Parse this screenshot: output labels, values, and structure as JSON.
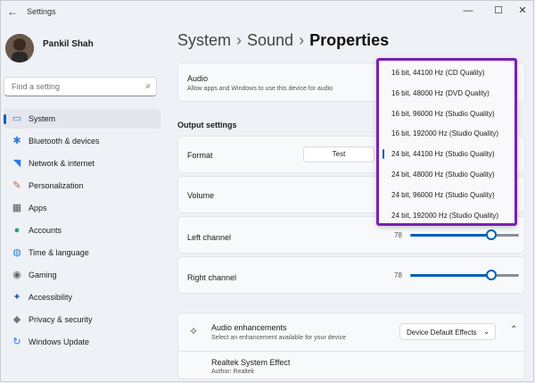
{
  "window": {
    "title": "Settings",
    "back_icon": "←",
    "min_icon": "—",
    "max_icon": "☐",
    "close_icon": "✕"
  },
  "user": {
    "name": "Pankil Shah"
  },
  "search": {
    "placeholder": "Find a setting"
  },
  "sidebar": {
    "items": [
      {
        "label": "System",
        "icon": "system-icon",
        "glyph": "▭",
        "color": "#2a7de1",
        "active": true
      },
      {
        "label": "Bluetooth & devices",
        "icon": "bluetooth-icon",
        "glyph": "✱",
        "color": "#2a7de1"
      },
      {
        "label": "Network & internet",
        "icon": "wifi-icon",
        "glyph": "◥",
        "color": "#2a7de1"
      },
      {
        "label": "Personalization",
        "icon": "brush-icon",
        "glyph": "✎",
        "color": "#c06a2a"
      },
      {
        "label": "Apps",
        "icon": "apps-icon",
        "glyph": "▦",
        "color": "#555"
      },
      {
        "label": "Accounts",
        "icon": "accounts-icon",
        "glyph": "●",
        "color": "#2aa06a"
      },
      {
        "label": "Time & language",
        "icon": "globe-icon",
        "glyph": "◍",
        "color": "#2a7de1"
      },
      {
        "label": "Gaming",
        "icon": "gaming-icon",
        "glyph": "◉",
        "color": "#666"
      },
      {
        "label": "Accessibility",
        "icon": "accessibility-icon",
        "glyph": "✦",
        "color": "#1e5fb5"
      },
      {
        "label": "Privacy & security",
        "icon": "shield-icon",
        "glyph": "◆",
        "color": "#777"
      },
      {
        "label": "Windows Update",
        "icon": "update-icon",
        "glyph": "↻",
        "color": "#2a7de1"
      }
    ]
  },
  "breadcrumb": {
    "part1": "System",
    "part2": "Sound",
    "current": "Properties",
    "sep": "›"
  },
  "audio": {
    "title": "Audio",
    "desc": "Allow apps and Windows to use this device for audio"
  },
  "output": {
    "section": "Output settings",
    "format_label": "Format",
    "test_label": "Test",
    "volume_label": "Volume",
    "left_label": "Left channel",
    "left_value": "78",
    "right_label": "Right channel",
    "right_value": "78"
  },
  "format_options": [
    "16 bit, 44100 Hz (CD Quality)",
    "16 bit, 48000 Hz (DVD Quality)",
    "16 bit, 96000 Hz (Studio Quality)",
    "16 bit, 192000 Hz (Studio Quality)",
    "24 bit, 44100 Hz (Studio Quality)",
    "24 bit, 48000 Hz (Studio Quality)",
    "24 bit, 96000 Hz (Studio Quality)",
    "24 bit, 192000 Hz (Studio Quality)"
  ],
  "format_selected_index": 4,
  "enhancements": {
    "title": "Audio enhancements",
    "desc": "Select an enhancement available for your device",
    "value": "Device Default Effects",
    "effect_name": "Realtek System Effect",
    "author": "Author: Realtek"
  },
  "colors": {
    "accent": "#005fb8",
    "highlight_border": "#7a1fb3"
  }
}
